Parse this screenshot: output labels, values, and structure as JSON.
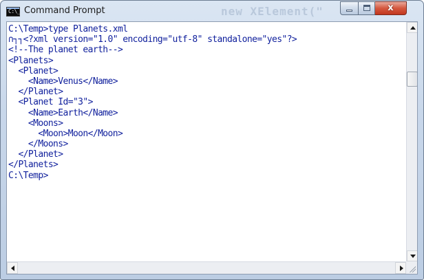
{
  "window": {
    "title": "Command Prompt",
    "icon": "command-prompt-icon",
    "icon_text": "C:\\_",
    "background_watermark": "new XElement(\"",
    "colors": {
      "console_text": "#0f1f9c",
      "console_background": "#ffffff",
      "close_button": "#c8402a"
    }
  },
  "title_buttons": {
    "minimize": "minimize-icon",
    "maximize": "maximize-icon",
    "close": "close-icon",
    "close_glyph": "x"
  },
  "console": {
    "lines": [
      "C:\\Temp>type Planets.xml",
      "∩┐┐<?xml version=\"1.0\" encoding=\"utf-8\" standalone=\"yes\"?>",
      "<!--The planet earth-->",
      "<Planets>",
      "  <Planet>",
      "    <Name>Venus</Name>",
      "  </Planet>",
      "  <Planet Id=\"3\">",
      "    <Name>Earth</Name>",
      "    <Moons>",
      "      <Moon>Moon</Moon>",
      "    </Moons>",
      "  </Planet>",
      "</Planets>",
      "C:\\Temp>"
    ]
  },
  "scrollbars": {
    "vertical": {
      "up": "arrow-up-icon",
      "down": "arrow-down-icon"
    },
    "horizontal": {
      "left": "arrow-left-icon",
      "right": "arrow-right-icon"
    }
  }
}
